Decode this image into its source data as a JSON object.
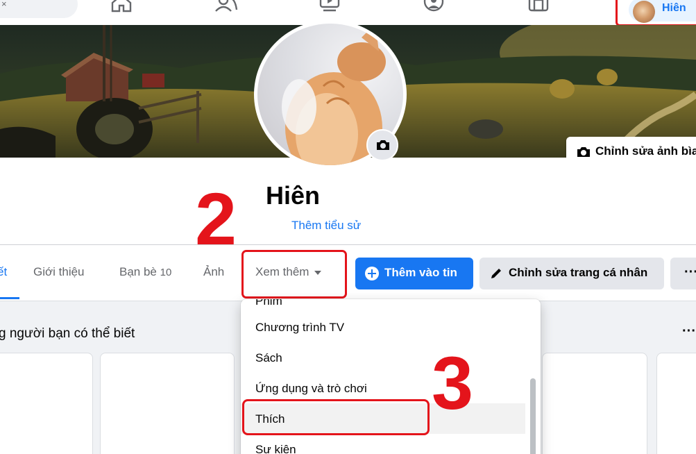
{
  "topbar": {
    "search_clear_glyph": "×",
    "nav_icons": [
      "home-icon",
      "friends-icon",
      "watch-icon",
      "groups-icon",
      "gaming-icon"
    ],
    "profile_name": "Hiên"
  },
  "cover": {
    "edit_cover_label": "Chỉnh sửa ảnh bìa"
  },
  "profile": {
    "name": "Hiên",
    "bio_link": "Thêm tiểu sử"
  },
  "annotations": {
    "step_2": "2",
    "step_3": "3",
    "highlight_color": "#e4141b"
  },
  "tabs": {
    "posts_partial": "ết",
    "about": "Giới thiệu",
    "friends": "Bạn bè",
    "friends_count": "10",
    "photos": "Ảnh",
    "see_more": "Xem thêm"
  },
  "actions": {
    "add_story": "Thêm vào tin",
    "edit_profile": "Chỉnh sửa trang cá nhân",
    "more": "···",
    "accent_color": "#1877f2"
  },
  "suggestions": {
    "title_partial": "g người bạn có thể biết",
    "more": "···"
  },
  "dropdown": {
    "items": [
      {
        "label": "Phim"
      },
      {
        "label": "Chương trình TV"
      },
      {
        "label": "Sách"
      },
      {
        "label": "Ứng dụng và trò chơi"
      },
      {
        "label": "Thích"
      },
      {
        "label": "Sự kiện"
      }
    ],
    "highlighted_item": "Thích"
  }
}
